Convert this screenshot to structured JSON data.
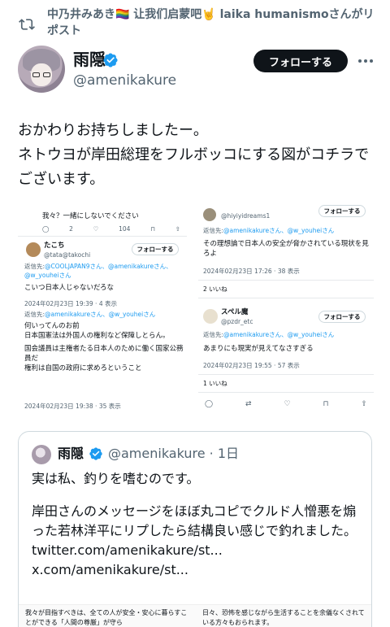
{
  "repost": {
    "text": "中乃井みあき🏳️‍🌈 让我们启蒙吧🤘 laika humanismoさんがリポスト"
  },
  "author": {
    "name": "雨隠",
    "handle": "@amenikakure",
    "follow_label": "フォローする"
  },
  "tweet": {
    "lines": [
      "おかわりお持ちしましたー。",
      "ネトウヨが岸田総理をフルボッコにする図がコチラでございます。"
    ]
  },
  "screenshot": {
    "left": {
      "top_text": "我々？一緒にしないでください",
      "top_counts": [
        "2",
        "104"
      ],
      "reply_user": {
        "name": "たこち",
        "handle": "@tata@takochi",
        "follow": "フォローする",
        "reply_to_prefix": "返信先:",
        "reply_to": "@COOLJAPAN9さん、@amenikakureさん、@w_youheiさん",
        "text": "こいつ日本人じゃないだろな",
        "meta": "2024年02月23日 19:39 · 4 表示"
      },
      "second": {
        "reply_to_prefix": "返信先:",
        "reply_to": "@amenikakureさん、@w_youheiさん",
        "lines": [
          "何いってんのお前",
          "日本国憲法は外国人の権利など保障しとらん。",
          "国会議員は主権者たる日本人のために働く国家公務員だ",
          "権利は自国の政府に求めろということ"
        ],
        "meta": "2024年02月23日 19:38 · 35 表示"
      }
    },
    "right": {
      "top_handle": "@hiyiyidreams1",
      "top_follow": "フォローする",
      "reply_to_prefix": "返信先:",
      "reply_to": "@amenikakureさん、@w_youheiさん",
      "text": "その理想論で日本人の安全が脅かされている現状を見ろよ",
      "meta": "2024年02月23日 17:26 · 38 表示",
      "likes": "2 いいね",
      "second_user": {
        "name": "スペル魔",
        "handle": "@pzdr_etc",
        "follow": "フォローする",
        "reply_to_prefix": "返信先:",
        "reply_to": "@amenikakureさん、@w_youheiさん",
        "text": "あまりにも現実が見えてなさすぎる",
        "meta": "2024年02月23日 19:55 · 57 表示",
        "likes": "1 いいね"
      }
    }
  },
  "quote": {
    "name": "雨隠",
    "handle": "@amenikakure · 1日",
    "para1": "実は私、釣りを嗜むのです。",
    "para2": "岸田さんのメッセージをほぼ丸コピでクルド人憎悪を煽った若林洋平にリプしたら結構良い感じで釣れました。",
    "link": "twitter.com/amenikakure/st... x.com/amenikakure/st...",
    "cut_left": "我々が目指すべきは、全ての人が安全・安心に暮らすことができる「人間の尊厳」が守ら",
    "cut_right": "日々、恐怖を感じながら生活することを余儀なくされている方々もおられます。"
  },
  "colors": {
    "accent": "#1d9bf0",
    "text": "#0f1419",
    "secondary": "#536471",
    "follow_bg": "#0f1419"
  }
}
